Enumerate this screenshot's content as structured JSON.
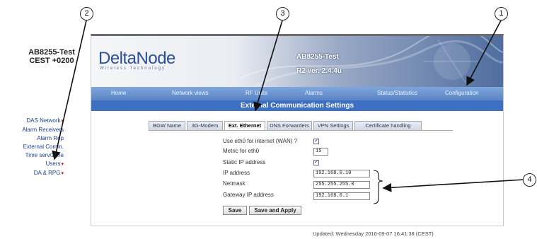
{
  "device": {
    "name": "AB8255-Test",
    "timezone": "CEST +0200"
  },
  "sidebar": {
    "items": [
      {
        "label": "DAS Network",
        "caret": "▾"
      },
      {
        "label": "Alarm Receivers",
        "caret": ""
      },
      {
        "label": "Alarm Rep",
        "caret": ""
      },
      {
        "label": "External Comm.",
        "caret": ""
      },
      {
        "label": "Time serv/zone",
        "caret": ""
      },
      {
        "label": "Users",
        "caret": "▾"
      },
      {
        "label": "DA & RPG",
        "caret": "▾"
      }
    ]
  },
  "header": {
    "logo": "DeltaNode",
    "logo_sub": "Wireless Technology",
    "device_title": "AB8255-Test",
    "version": "R2 ver. 2.4.4u"
  },
  "menu": [
    "Home",
    "Network views",
    "RF Units",
    "Alarms",
    "Status/Statistics",
    "Configuration"
  ],
  "section_title": "External Communication Settings",
  "tabs": [
    "BGW Name",
    "3G-Modem",
    "Ext. Ethernet",
    "DNS Forwarders",
    "VPN Settings",
    "Certificate handling"
  ],
  "active_tab": "Ext. Ethernet",
  "form": {
    "use_eth0": {
      "label": "Use eth0 for internet (WAN) ?",
      "checked": true
    },
    "metric": {
      "label": "Metric for eth0",
      "value": "15"
    },
    "static_ip": {
      "label": "Static IP address",
      "checked": true
    },
    "ip": {
      "label": "IP address",
      "value": "192.168.0.10"
    },
    "netmask": {
      "label": "Netmask",
      "value": "255.255.255.0"
    },
    "gateway": {
      "label": "Gateway IP address",
      "value": "192.168.0.1"
    },
    "save_label": "Save",
    "save_apply_label": "Save and Apply"
  },
  "updated": "Updated: Wednesday 2016-09-07 16:41:38 (CEST)",
  "callouts": [
    "1",
    "2",
    "3",
    "4"
  ]
}
